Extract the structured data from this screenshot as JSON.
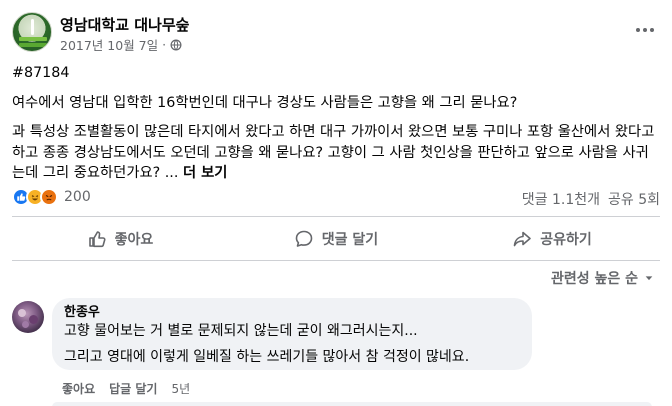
{
  "post": {
    "page_name": "영남대학교 대나무숲",
    "date": "2017년 10월 7일",
    "separator": "·",
    "hashtag": "#87184",
    "headline": "여수에서 영남대 입학한 16학번인데 대구나 경상도 사람들은 고향을 왜 그리 묻나요?",
    "body": "과 특성상 조별활동이 많은데 타지에서 왔다고 하면 대구 가까이서 왔으면 보통 구미나 포항 울산에서 왔다고 하고 종종 경상남도에서도 오던데 고향을 왜 묻나요? 고향이 그 사람 첫인상을 판단하고 앞으로 사람을 사귀는데 그리 중요하던가요? ...",
    "see_more": "더 보기",
    "icons": {
      "globe": "globe-icon",
      "more": "more-options-icon"
    }
  },
  "stats": {
    "reaction_count": "200",
    "reactions": [
      {
        "name": "like-reaction-icon",
        "glyph": "👍"
      },
      {
        "name": "haha-reaction-icon",
        "glyph": "😆"
      },
      {
        "name": "angry-reaction-icon",
        "glyph": "😡"
      }
    ],
    "comments": "댓글 1.1천개",
    "shares": "공유 5회"
  },
  "actions": {
    "like": "좋아요",
    "comment": "댓글 달기",
    "share": "공유하기"
  },
  "sort": {
    "label": "관련성 높은 순"
  },
  "comment": {
    "author": "한종우",
    "line1": "고향 물어보는 거 별로 문제되지 않는데 굳이 왜그러시는지...",
    "line2": "그리고 영대에 이렇게 일베질 하는 쓰레기들 많아서 참 걱정이 많네요.",
    "like_label": "좋아요",
    "reply_label": "답글 달기",
    "time": "5년"
  },
  "colors": {
    "text": "#050505",
    "secondary": "#65676b",
    "like_blue": "#1877f2",
    "bubble_bg": "#f0f2f5",
    "divider": "#ced0d4"
  }
}
